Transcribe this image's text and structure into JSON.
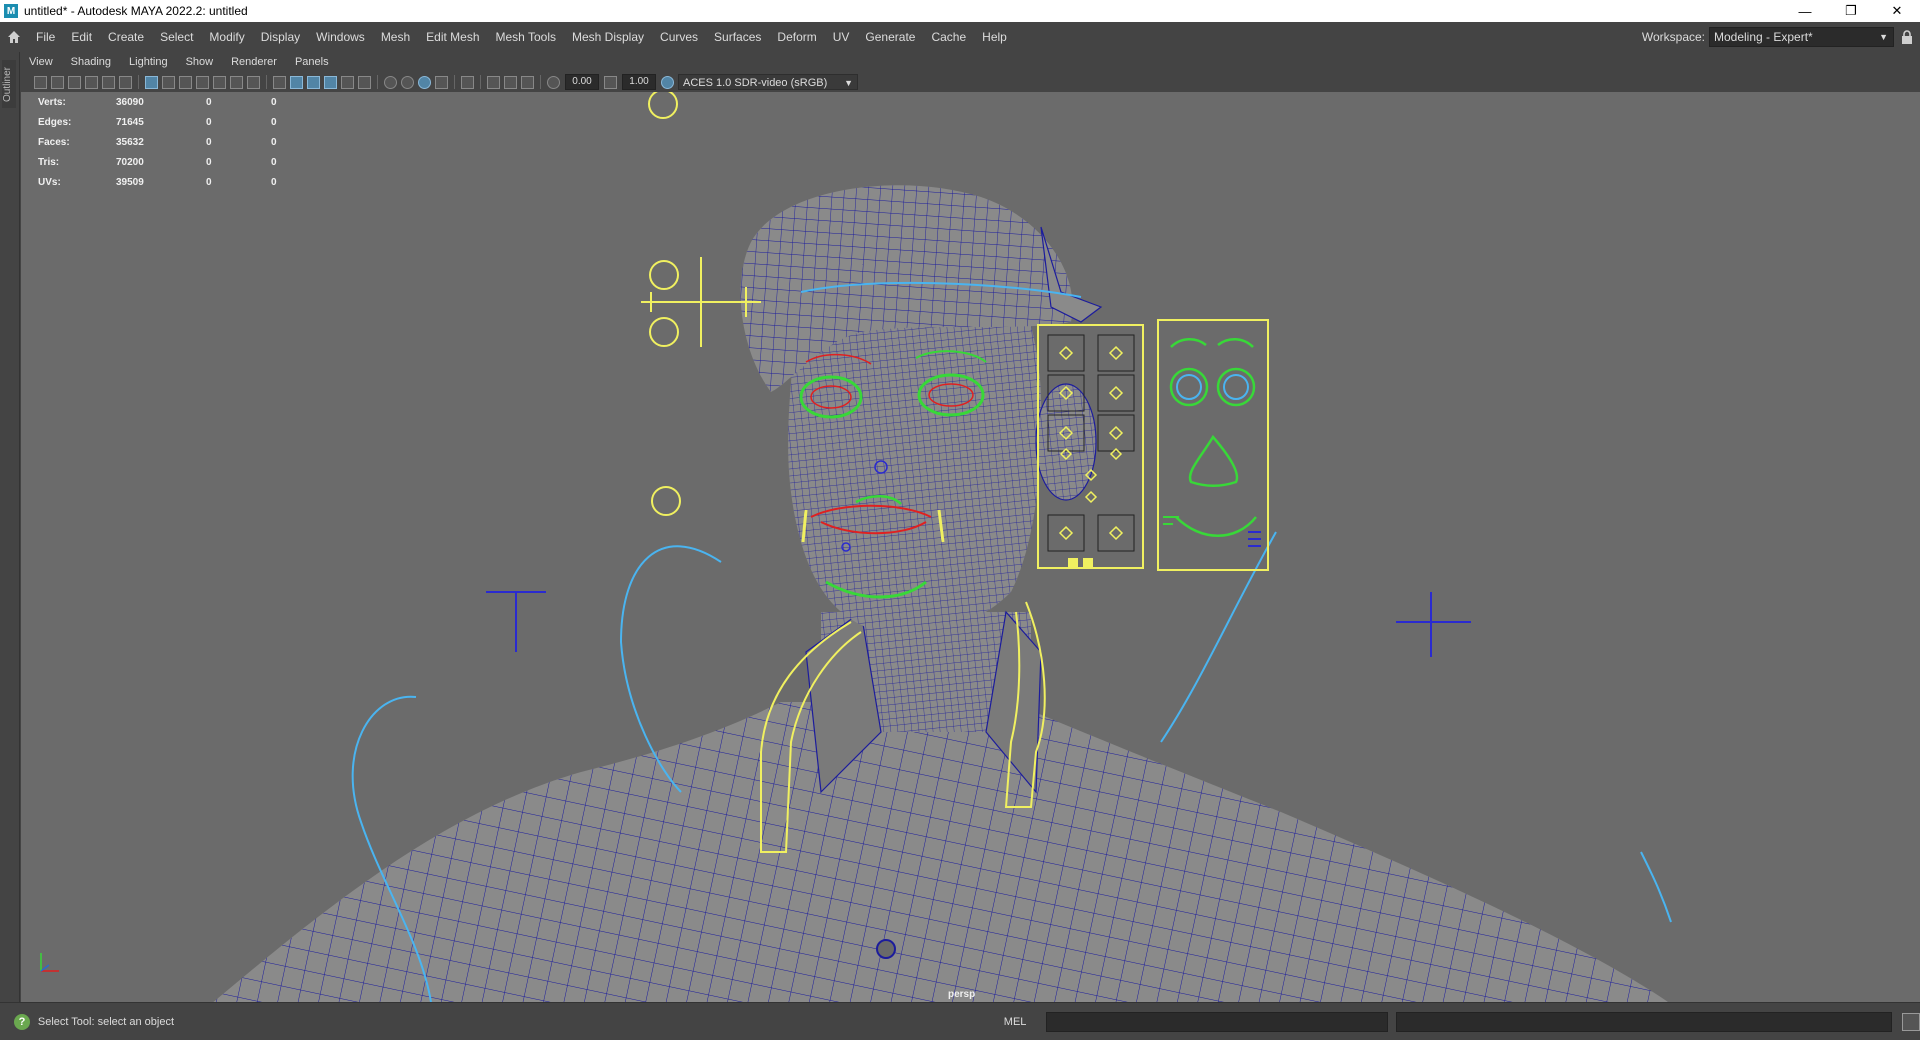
{
  "window": {
    "title": "untitled* - Autodesk MAYA 2022.2: untitled",
    "app_icon_text": "M"
  },
  "menubar": {
    "items": [
      "File",
      "Edit",
      "Create",
      "Select",
      "Modify",
      "Display",
      "Windows",
      "Mesh",
      "Edit Mesh",
      "Mesh Tools",
      "Mesh Display",
      "Curves",
      "Surfaces",
      "Deform",
      "UV",
      "Generate",
      "Cache",
      "Help"
    ],
    "workspace_label": "Workspace:",
    "workspace_value": "Modeling - Expert*"
  },
  "left_strip": {
    "outliner_label": "Outliner"
  },
  "panel_menu": {
    "items": [
      "View",
      "Shading",
      "Lighting",
      "Show",
      "Renderer",
      "Panels"
    ]
  },
  "panel_toolbar": {
    "exposure_value": "0.00",
    "gamma_value": "1.00",
    "color_space": "ACES 1.0 SDR-video (sRGB)"
  },
  "hud": {
    "rows": [
      {
        "label": "Verts:",
        "value": "36090",
        "sel": "0",
        "comp": "0"
      },
      {
        "label": "Edges:",
        "value": "71645",
        "sel": "0",
        "comp": "0"
      },
      {
        "label": "Faces:",
        "value": "35632",
        "sel": "0",
        "comp": "0"
      },
      {
        "label": "Tris:",
        "value": "70200",
        "sel": "0",
        "comp": "0"
      },
      {
        "label": "UVs:",
        "value": "39509",
        "sel": "0",
        "comp": "0"
      }
    ]
  },
  "viewport": {
    "camera_label": "persp"
  },
  "bottom": {
    "status_text": "Select Tool: select an object",
    "mel_label": "MEL"
  },
  "colors": {
    "wire": "#1c1c9c",
    "yellow_ctrl": "#f0f060",
    "green_ctrl": "#38d838",
    "cyan_curve": "#4ab4f0",
    "red_ctrl": "#e02020",
    "blue_ctrl": "#2a2ad0"
  }
}
